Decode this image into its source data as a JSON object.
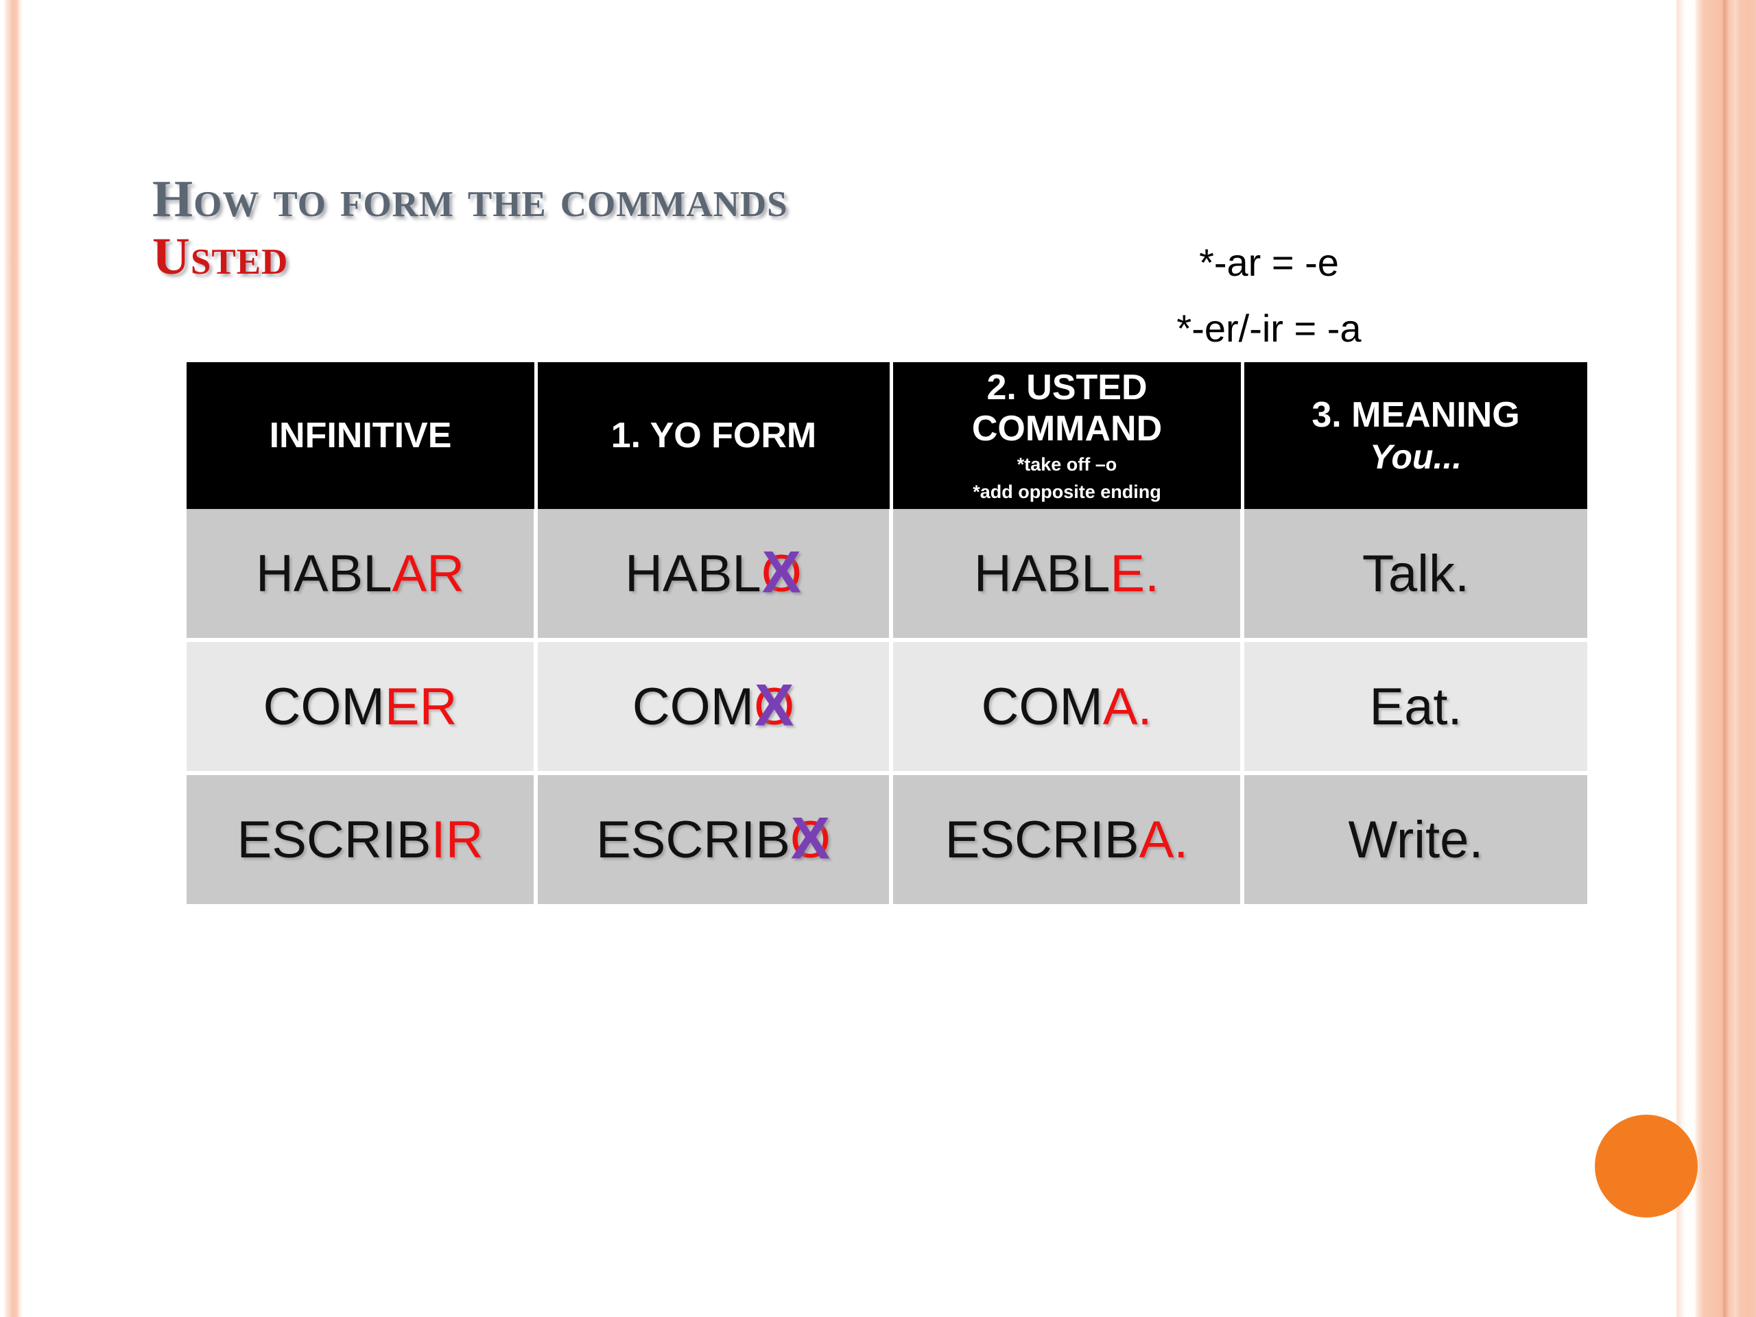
{
  "slide": {
    "title_main": "How to form the commands",
    "title_sub": "Usted",
    "colors": {
      "title_main": "#5c6773",
      "title_sub": "#d01717",
      "accent_orange": "#f47c20",
      "highlight_red": "#ee1111",
      "strike_purple": "#7b3fb5",
      "header_bg": "#000000",
      "row_shade_dark": "#c9c9c9",
      "row_shade_light": "#e8e8e8",
      "border_peach": "#f8c3ab"
    }
  },
  "rule_notes": [
    "*-ar = -e",
    "*-er/-ir = -a"
  ],
  "table": {
    "headers": [
      {
        "main": "INFINITIVE",
        "sub": "",
        "sub_italic": ""
      },
      {
        "main": "1. YO FORM",
        "sub": "",
        "sub_italic": ""
      },
      {
        "main": "2. USTED COMMAND",
        "sub": "*take off –o\n*add opposite ending",
        "sub_italic": ""
      },
      {
        "main": "3. MEANING",
        "sub": "",
        "sub_italic": "You..."
      }
    ],
    "header_sub_lines": {
      "usted_command": [
        "*take off –o",
        "*add opposite ending"
      ]
    },
    "rows": [
      {
        "shade": "dark",
        "infinitive": {
          "stem": "HABL",
          "ending": "AR"
        },
        "yo_form": {
          "stem": "HABL",
          "struck": "O",
          "mark": "X"
        },
        "command": {
          "stem": "HABL",
          "ending": "E."
        },
        "meaning": "Talk."
      },
      {
        "shade": "light",
        "infinitive": {
          "stem": "COM",
          "ending": "ER"
        },
        "yo_form": {
          "stem": "COM",
          "struck": "O",
          "mark": "X"
        },
        "command": {
          "stem": "COM",
          "ending": "A."
        },
        "meaning": "Eat."
      },
      {
        "shade": "dark",
        "infinitive": {
          "stem": "ESCRIB",
          "ending": "IR"
        },
        "yo_form": {
          "stem": "ESCRIB",
          "struck": "O",
          "mark": "X"
        },
        "command": {
          "stem": "ESCRIB",
          "ending": "A."
        },
        "meaning": "Write."
      }
    ]
  }
}
